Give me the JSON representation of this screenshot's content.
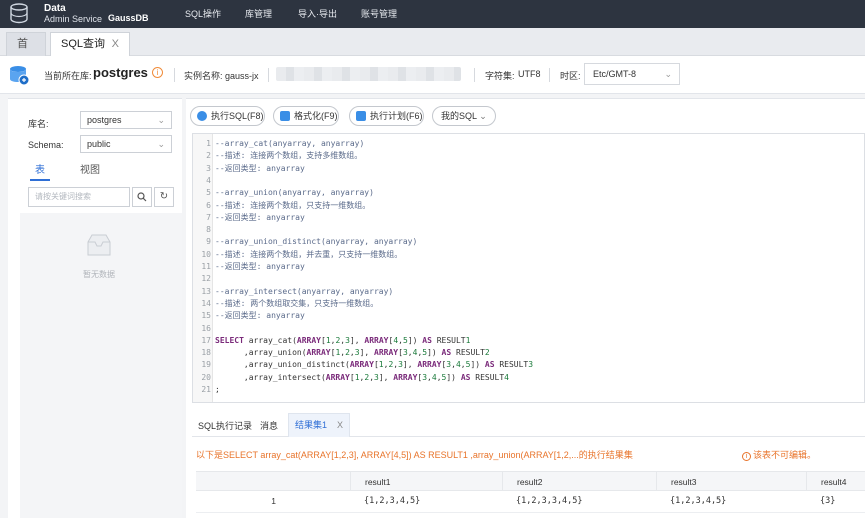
{
  "app": {
    "brand_line1": "Data",
    "brand_line2": "Admin Service",
    "brand_product": "GaussDB",
    "nav": [
      "SQL操作",
      "库管理",
      "导入·导出",
      "账号管理"
    ]
  },
  "tabs": {
    "home": "首页",
    "sql": "SQL查询",
    "close": "X"
  },
  "infobar": {
    "current_db_label": "当前所在库:",
    "current_db": "postgres",
    "info_icon": "i",
    "instance_label": "实例名称: gauss-jx",
    "charset_label": "字符集:",
    "charset": "UTF8",
    "timezone_label": "时区:",
    "timezone": "Etc/GMT-8"
  },
  "left": {
    "db_label": "库名:",
    "db_value": "postgres",
    "schema_label": "Schema:",
    "schema_value": "public",
    "tab_table": "表",
    "tab_view": "视图",
    "search_placeholder": "请按关键词搜索",
    "empty_text": "暂无数据"
  },
  "toolbar": {
    "execute": "执行SQL(F8)",
    "format": "格式化(F9)",
    "plan": "执行计划(F6)",
    "my_sql": "我的SQL"
  },
  "editor": {
    "lines": [
      "--array_cat(anyarray, anyarray)",
      "--描述: 连接两个数组，支持多维数组。",
      "--返回类型: anyarray",
      "",
      "--array_union(anyarray, anyarray)",
      "--描述: 连接两个数组，只支持一维数组。",
      "--返回类型: anyarray",
      "",
      "--array_union_distinct(anyarray, anyarray)",
      "--描述: 连接两个数组，并去重，只支持一维数组。",
      "--返回类型: anyarray",
      "",
      "--array_intersect(anyarray, anyarray)",
      "--描述: 两个数组取交集，只支持一维数组。",
      "--返回类型: anyarray",
      "",
      "SELECT array_cat(ARRAY[1,2,3], ARRAY[4,5]) AS RESULT1",
      "      ,array_union(ARRAY[1,2,3], ARRAY[3,4,5]) AS RESULT2",
      "      ,array_union_distinct(ARRAY[1,2,3], ARRAY[3,4,5]) AS RESULT3",
      "      ,array_intersect(ARRAY[1,2,3], ARRAY[3,4,5]) AS RESULT4",
      ";"
    ]
  },
  "results": {
    "tab_history": "SQL执行记录",
    "tab_messages": "消息",
    "tab_result": "结果集1",
    "close": "X",
    "message": "以下是SELECT array_cat(ARRAY[1,2,3], ARRAY[4,5]) AS RESULT1 ,array_union(ARRAY[1,2,...的执行结果集",
    "warning": "该表不可编辑。",
    "columns": [
      "",
      "result1",
      "result2",
      "result3",
      "result4"
    ],
    "rows": [
      [
        "1",
        "{1,2,3,4,5}",
        "{1,2,3,3,4,5}",
        "{1,2,3,4,5}",
        "{3}"
      ]
    ]
  },
  "colors": {
    "topbar": "#2d3440",
    "accent": "#2f6fd6",
    "warning": "#e8742b"
  }
}
